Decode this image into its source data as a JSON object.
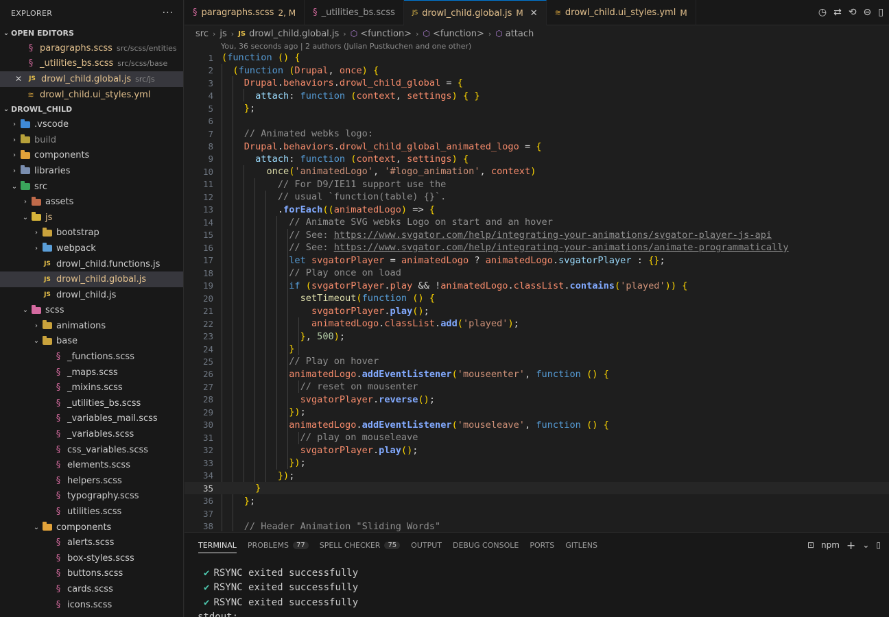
{
  "sidebar": {
    "title": "EXPLORER",
    "open_editors_title": "OPEN EDITORS",
    "open_editors": [
      {
        "name": "paragraphs.scss",
        "path": "src/scss/entities",
        "type": "scss"
      },
      {
        "name": "_utilities_bs.scss",
        "path": "src/scss/base",
        "type": "scss"
      },
      {
        "name": "drowl_child.global.js",
        "path": "src/js",
        "type": "js",
        "close": "✕"
      },
      {
        "name": "drowl_child.ui_styles.yml",
        "path": "",
        "type": "yml"
      }
    ],
    "project_title": "DROWL_CHILD",
    "tree": [
      {
        "name": ".vscode",
        "depth": 0,
        "kind": "folder",
        "open": false,
        "folder": "f-vscode"
      },
      {
        "name": "build",
        "depth": 0,
        "kind": "folder",
        "open": false,
        "folder": "f-build",
        "dim": true
      },
      {
        "name": "components",
        "depth": 0,
        "kind": "folder",
        "open": false,
        "folder": "f-comp"
      },
      {
        "name": "libraries",
        "depth": 0,
        "kind": "folder",
        "open": false,
        "folder": "f-lib"
      },
      {
        "name": "src",
        "depth": 0,
        "kind": "folder",
        "open": true,
        "folder": "f-src"
      },
      {
        "name": "assets",
        "depth": 1,
        "kind": "folder",
        "open": false,
        "folder": "f-assets"
      },
      {
        "name": "js",
        "depth": 1,
        "kind": "folder",
        "open": true,
        "folder": "f-js",
        "mod": true
      },
      {
        "name": "bootstrap",
        "depth": 2,
        "kind": "folder",
        "open": false,
        "folder": "f-boot"
      },
      {
        "name": "webpack",
        "depth": 2,
        "kind": "folder",
        "open": false,
        "folder": "f-web"
      },
      {
        "name": "drowl_child.functions.js",
        "depth": 2,
        "kind": "js"
      },
      {
        "name": "drowl_child.global.js",
        "depth": 2,
        "kind": "js",
        "selected": true,
        "mod": true
      },
      {
        "name": "drowl_child.js",
        "depth": 2,
        "kind": "js"
      },
      {
        "name": "scss",
        "depth": 1,
        "kind": "folder",
        "open": true,
        "folder": "f-scss"
      },
      {
        "name": "animations",
        "depth": 2,
        "kind": "folder",
        "open": false,
        "folder": "f-anim"
      },
      {
        "name": "base",
        "depth": 2,
        "kind": "folder",
        "open": true,
        "folder": "f-base"
      },
      {
        "name": "_functions.scss",
        "depth": 3,
        "kind": "scss"
      },
      {
        "name": "_maps.scss",
        "depth": 3,
        "kind": "scss"
      },
      {
        "name": "_mixins.scss",
        "depth": 3,
        "kind": "scss"
      },
      {
        "name": "_utilities_bs.scss",
        "depth": 3,
        "kind": "scss"
      },
      {
        "name": "_variables_mail.scss",
        "depth": 3,
        "kind": "scss"
      },
      {
        "name": "_variables.scss",
        "depth": 3,
        "kind": "scss"
      },
      {
        "name": "css_variables.scss",
        "depth": 3,
        "kind": "scss"
      },
      {
        "name": "elements.scss",
        "depth": 3,
        "kind": "scss"
      },
      {
        "name": "helpers.scss",
        "depth": 3,
        "kind": "scss"
      },
      {
        "name": "typography.scss",
        "depth": 3,
        "kind": "scss"
      },
      {
        "name": "utilities.scss",
        "depth": 3,
        "kind": "scss"
      },
      {
        "name": "components",
        "depth": 2,
        "kind": "folder",
        "open": true,
        "folder": "f-comp"
      },
      {
        "name": "alerts.scss",
        "depth": 3,
        "kind": "scss"
      },
      {
        "name": "box-styles.scss",
        "depth": 3,
        "kind": "scss"
      },
      {
        "name": "buttons.scss",
        "depth": 3,
        "kind": "scss"
      },
      {
        "name": "cards.scss",
        "depth": 3,
        "kind": "scss"
      },
      {
        "name": "icons.scss",
        "depth": 3,
        "kind": "scss"
      }
    ]
  },
  "tabs": [
    {
      "name": "paragraphs.scss",
      "badge": "2, M",
      "type": "scss",
      "active": false
    },
    {
      "name": "_utilities_bs.scss",
      "badge": "",
      "type": "scss",
      "active": false
    },
    {
      "name": "drowl_child.global.js",
      "badge": "M",
      "type": "js",
      "active": true,
      "close": "✕"
    },
    {
      "name": "drowl_child.ui_styles.yml",
      "badge": "M",
      "type": "yml",
      "active": false
    }
  ],
  "breadcrumb": [
    "src",
    "js",
    "drowl_child.global.js",
    "<function>",
    "<function>",
    "attach"
  ],
  "blame": "You, 36 seconds ago | 2 authors (Julian Pustkuchen and one other)",
  "editor": {
    "current_line": 35,
    "lines": [
      {
        "n": 1,
        "text": "(function () {"
      },
      {
        "n": 2,
        "text": "  (function (Drupal, once) {"
      },
      {
        "n": 3,
        "text": "    Drupal.behaviors.drowl_child_global = {"
      },
      {
        "n": 4,
        "text": "      attach: function (context, settings) { }"
      },
      {
        "n": 5,
        "text": "    };"
      },
      {
        "n": 6,
        "text": ""
      },
      {
        "n": 7,
        "text": "    // Animated webks logo:"
      },
      {
        "n": 8,
        "text": "    Drupal.behaviors.drowl_child_global_animated_logo = {"
      },
      {
        "n": 9,
        "text": "      attach: function (context, settings) {"
      },
      {
        "n": 10,
        "text": "        once('animatedLogo', '#logo_animation', context)"
      },
      {
        "n": 11,
        "text": "          // For D9/IE11 support use the"
      },
      {
        "n": 12,
        "text": "          // usual `function(table) {}`."
      },
      {
        "n": 13,
        "text": "          .forEach((animatedLogo) => {"
      },
      {
        "n": 14,
        "text": "            // Animate SVG webks Logo on start and an hover"
      },
      {
        "n": 15,
        "text": "            // See: https://www.svgator.com/help/integrating-your-animations/svgator-player-js-api"
      },
      {
        "n": 16,
        "text": "            // See: https://www.svgator.com/help/integrating-your-animations/animate-programmatically"
      },
      {
        "n": 17,
        "text": "            let svgatorPlayer = animatedLogo ? animatedLogo.svgatorPlayer : {};"
      },
      {
        "n": 18,
        "text": "            // Play once on load"
      },
      {
        "n": 19,
        "text": "            if (svgatorPlayer.play && !animatedLogo.classList.contains('played')) {"
      },
      {
        "n": 20,
        "text": "              setTimeout(function () {"
      },
      {
        "n": 21,
        "text": "                svgatorPlayer.play();"
      },
      {
        "n": 22,
        "text": "                animatedLogo.classList.add('played');"
      },
      {
        "n": 23,
        "text": "              }, 500);"
      },
      {
        "n": 24,
        "text": "            }"
      },
      {
        "n": 25,
        "text": "            // Play on hover"
      },
      {
        "n": 26,
        "text": "            animatedLogo.addEventListener('mouseenter', function () {"
      },
      {
        "n": 27,
        "text": "              // reset on mousenter"
      },
      {
        "n": 28,
        "text": "              svgatorPlayer.reverse();"
      },
      {
        "n": 29,
        "text": "            });"
      },
      {
        "n": 30,
        "text": "            animatedLogo.addEventListener('mouseleave', function () {"
      },
      {
        "n": 31,
        "text": "              // play on mouseleave"
      },
      {
        "n": 32,
        "text": "              svgatorPlayer.play();"
      },
      {
        "n": 33,
        "text": "            });"
      },
      {
        "n": 34,
        "text": "          });"
      },
      {
        "n": 35,
        "text": "      }"
      },
      {
        "n": 36,
        "text": "    };"
      },
      {
        "n": 37,
        "text": ""
      },
      {
        "n": 38,
        "text": "    // Header Animation \"Sliding Words\""
      }
    ]
  },
  "panel": {
    "tabs": [
      {
        "label": "TERMINAL",
        "badge": "",
        "active": true
      },
      {
        "label": "PROBLEMS",
        "badge": "77",
        "active": false
      },
      {
        "label": "SPELL CHECKER",
        "badge": "75",
        "active": false
      },
      {
        "label": "OUTPUT",
        "badge": "",
        "active": false
      },
      {
        "label": "DEBUG CONSOLE",
        "badge": "",
        "active": false
      },
      {
        "label": "PORTS",
        "badge": "",
        "active": false
      },
      {
        "label": "GITLENS",
        "badge": "",
        "active": false
      }
    ],
    "shell_label": "npm",
    "terminal_lines": [
      {
        "check": "✔",
        "text": "RSYNC exited successfully"
      },
      {
        "check": "✔",
        "text": "RSYNC exited successfully"
      },
      {
        "check": "✔",
        "text": "RSYNC exited successfully"
      },
      {
        "check": "",
        "text": "stdout:"
      }
    ]
  },
  "colors": {
    "accent": "#0078d4",
    "modified": "#e2c08d",
    "sidebar_bg": "#181818",
    "editor_bg": "#1e1e1e"
  }
}
